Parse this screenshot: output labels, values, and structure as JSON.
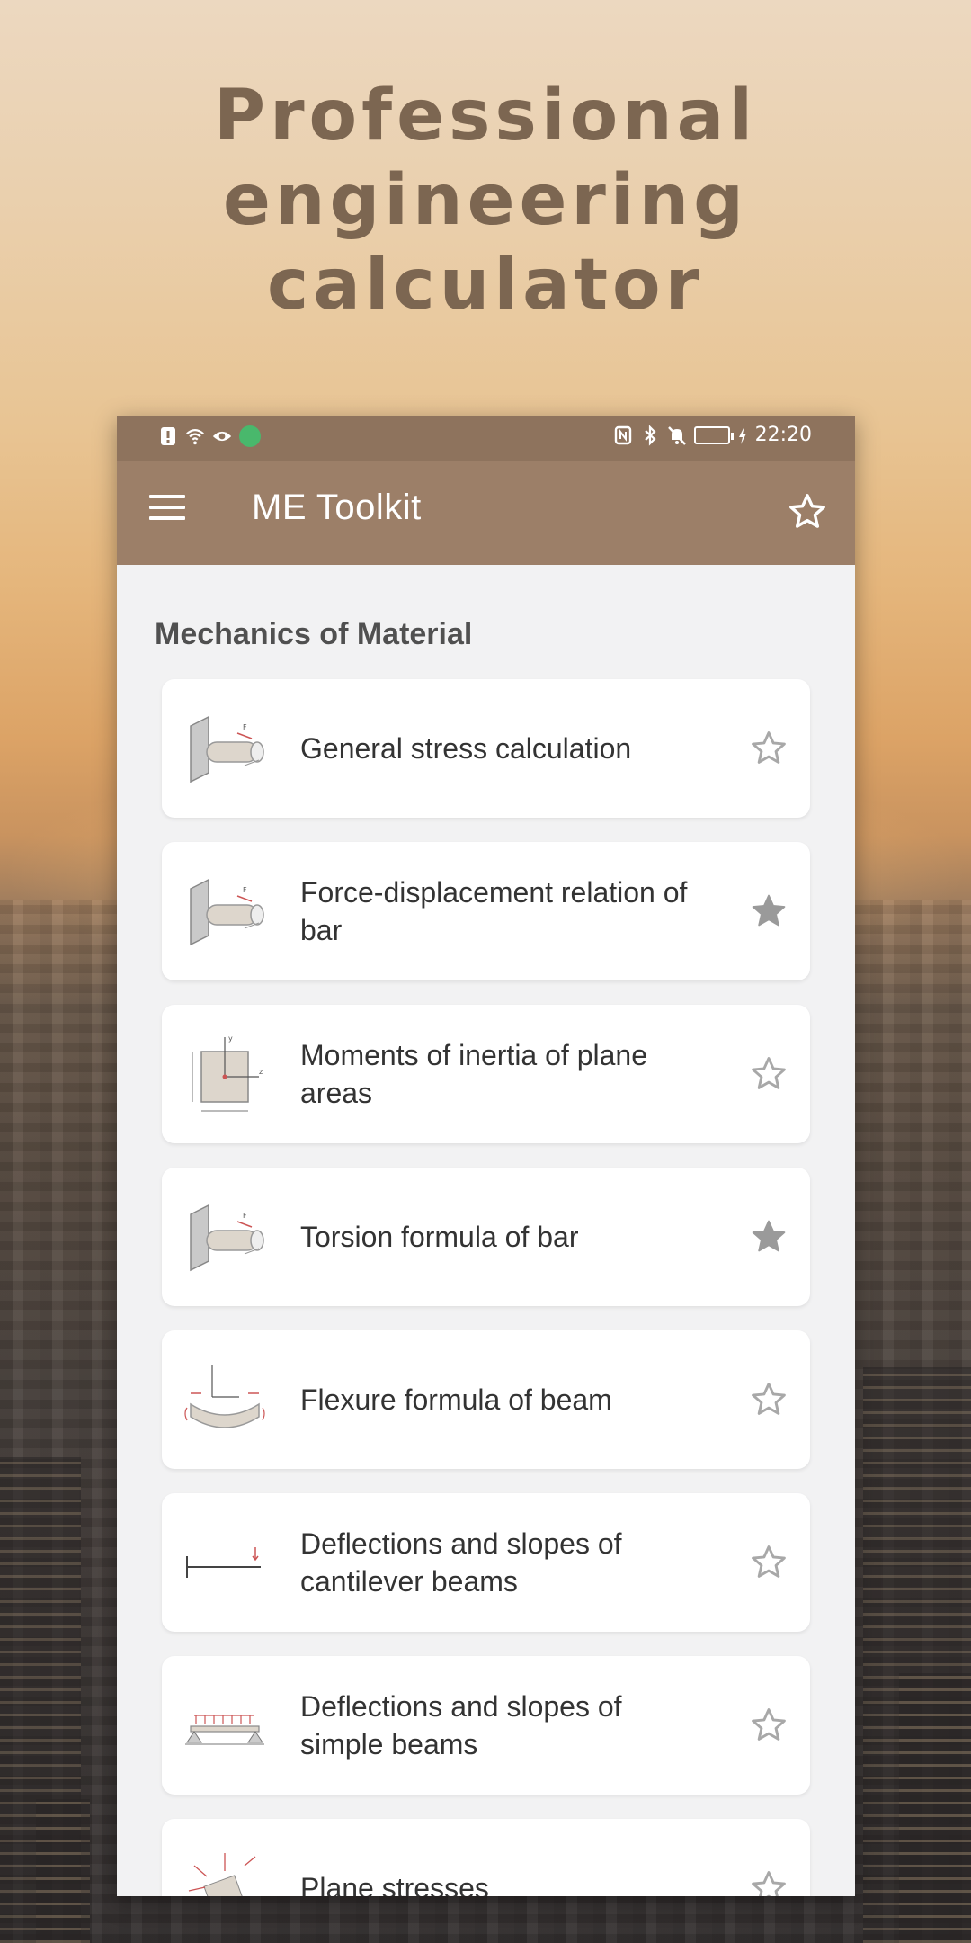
{
  "headline": {
    "line1": "Professional",
    "line2": "engineering",
    "line3": "calculator"
  },
  "statusbar": {
    "time": "22:20"
  },
  "appbar": {
    "title": "ME Toolkit",
    "menu_icon": "hamburger-menu-icon",
    "favorites_icon": "star-outline-icon"
  },
  "section": {
    "title": "Mechanics of Material"
  },
  "items": [
    {
      "label": "General stress calculation",
      "favorite": false,
      "thumbnail": "cantilever-bar-icon"
    },
    {
      "label": "Force-displacement relation of bar",
      "favorite": true,
      "thumbnail": "cantilever-bar-icon"
    },
    {
      "label": "Moments of inertia of plane areas",
      "favorite": false,
      "thumbnail": "plane-area-icon"
    },
    {
      "label": "Torsion formula of bar",
      "favorite": true,
      "thumbnail": "cantilever-bar-icon"
    },
    {
      "label": "Flexure formula of beam",
      "favorite": false,
      "thumbnail": "bent-beam-icon"
    },
    {
      "label": "Deflections and slopes of cantilever beams",
      "favorite": false,
      "thumbnail": "cantilever-beam-icon"
    },
    {
      "label": "Deflections and slopes of simple beams",
      "favorite": false,
      "thumbnail": "simple-beam-icon"
    },
    {
      "label": "Plane stresses",
      "favorite": false,
      "thumbnail": "plane-stress-icon"
    }
  ],
  "colors": {
    "statusbar": "#8e735d",
    "appbar": "#9c7f68",
    "headline": "#7c6651",
    "star_filled": "#9a9a9a",
    "star_outline": "#a8a8a8"
  }
}
